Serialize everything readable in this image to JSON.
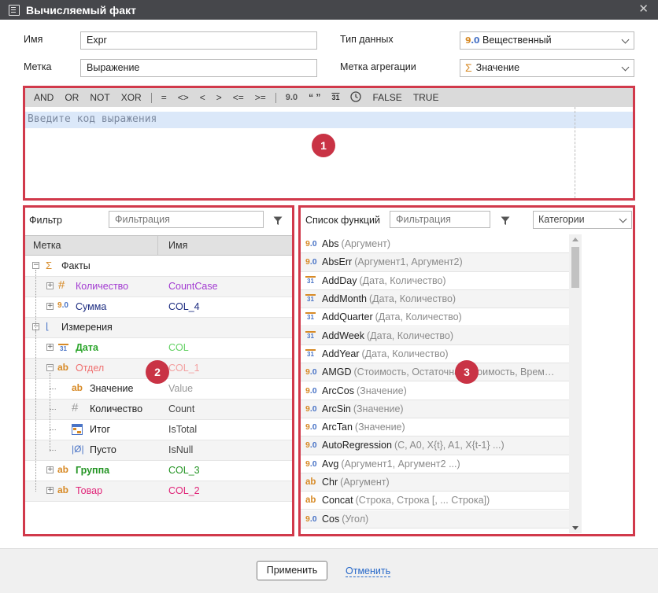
{
  "window": {
    "title": "Вычисляемый факт",
    "close": "✕"
  },
  "form": {
    "name_label": "Имя",
    "name_value": "Expr",
    "label_label": "Метка",
    "label_value": "Выражение",
    "datatype_label": "Тип данных",
    "datatype_value": "Вещественный",
    "agg_label": "Метка агрегации",
    "agg_value": "Значение"
  },
  "toolbar": {
    "ops": [
      "AND",
      "OR",
      "NOT",
      "XOR"
    ],
    "cmp": [
      "=",
      "<>",
      "<",
      ">",
      "<=",
      ">="
    ],
    "lit": [
      "9.0",
      "“ ”",
      "31",
      "clock",
      "FALSE",
      "TRUE"
    ]
  },
  "editor": {
    "placeholder": "Введите код выражения"
  },
  "badges": [
    "1",
    "2",
    "3"
  ],
  "fields_panel": {
    "filter_label": "Фильтр",
    "filter_placeholder": "Фильтрация",
    "col_label": "Метка",
    "col_name": "Имя",
    "rows": [
      {
        "label": "Факты",
        "name": ""
      },
      {
        "label": "Количество",
        "name": "CountCase"
      },
      {
        "label": "Сумма",
        "name": "COL_4"
      },
      {
        "label": "Измерения",
        "name": ""
      },
      {
        "label": "Дата",
        "name": "COL"
      },
      {
        "label": "Отдел",
        "name": "COL_1"
      },
      {
        "label": "Значение",
        "name": "Value"
      },
      {
        "label": "Количество",
        "name": "Count"
      },
      {
        "label": "Итог",
        "name": "IsTotal"
      },
      {
        "label": "Пусто",
        "name": "IsNull"
      },
      {
        "label": "Группа",
        "name": "COL_3"
      },
      {
        "label": "Товар",
        "name": "COL_2"
      }
    ]
  },
  "functions_panel": {
    "title": "Список функций",
    "filter_placeholder": "Фильтрация",
    "category_value": "Категории",
    "items": [
      {
        "type": "num",
        "name": "Abs",
        "args": "(Аргумент)"
      },
      {
        "type": "num",
        "name": "AbsErr",
        "args": "(Аргумент1, Аргумент2)"
      },
      {
        "type": "date",
        "name": "AddDay",
        "args": "(Дата, Количество)"
      },
      {
        "type": "date",
        "name": "AddMonth",
        "args": "(Дата, Количество)"
      },
      {
        "type": "date",
        "name": "AddQuarter",
        "args": "(Дата, Количество)"
      },
      {
        "type": "date",
        "name": "AddWeek",
        "args": "(Дата, Количество)"
      },
      {
        "type": "date",
        "name": "AddYear",
        "args": "(Дата, Количество)"
      },
      {
        "type": "num",
        "name": "AMGD",
        "args": "(Стоимость, Остаточная стоимость, Врем…"
      },
      {
        "type": "num",
        "name": "ArcCos",
        "args": "(Значение)"
      },
      {
        "type": "num",
        "name": "ArcSin",
        "args": "(Значение)"
      },
      {
        "type": "num",
        "name": "ArcTan",
        "args": "(Значение)"
      },
      {
        "type": "num",
        "name": "AutoRegression",
        "args": "(C, A0, X{t}, A1, X{t-1} ...)"
      },
      {
        "type": "num",
        "name": "Avg",
        "args": "(Аргумент1, Аргумент2 ...)"
      },
      {
        "type": "str",
        "name": "Chr",
        "args": "(Аргумент)"
      },
      {
        "type": "str",
        "name": "Concat",
        "args": "(Строка, Строка [, ... Строка])"
      },
      {
        "type": "num",
        "name": "Cos",
        "args": "(Угол)"
      }
    ]
  },
  "footer": {
    "apply": "Применить",
    "cancel": "Отменить"
  },
  "colors": {
    "accent_red": "#d1394b",
    "badge": "#c93345",
    "titlebar": "#46474b",
    "link": "#2869c9"
  }
}
